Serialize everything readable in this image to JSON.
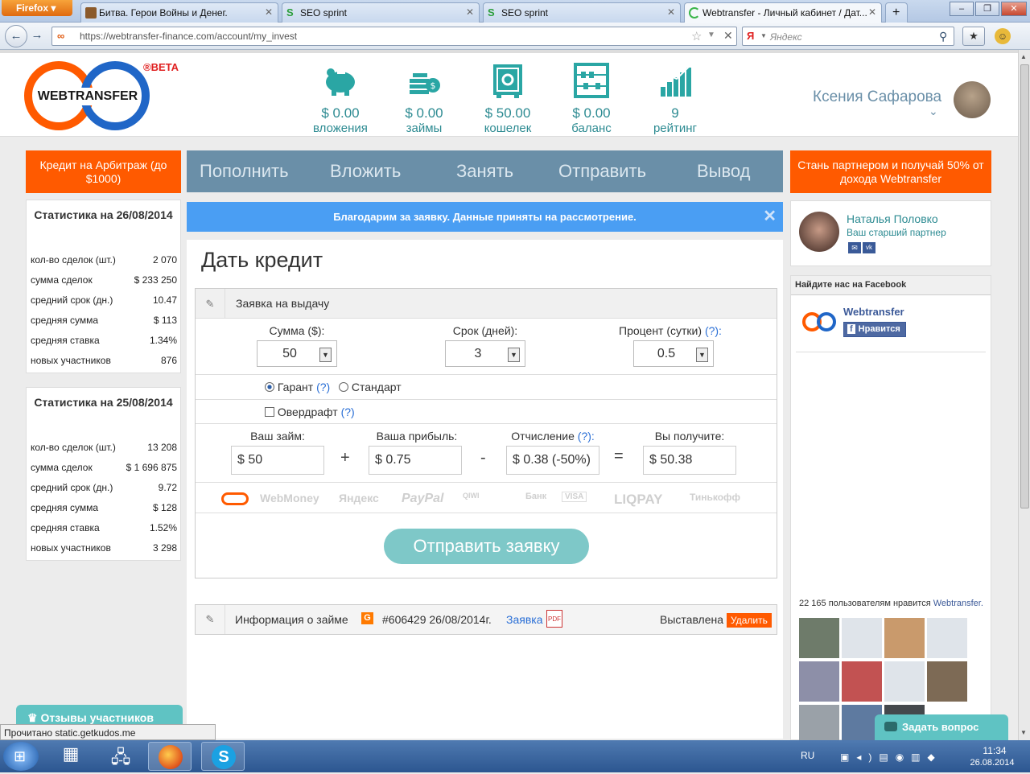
{
  "browser": {
    "firefox_button": "Firefox",
    "tabs": [
      {
        "title": "Битва. Герои Войны и Денег."
      },
      {
        "title": "SEO sprint"
      },
      {
        "title": "SEO sprint"
      },
      {
        "title": "Webtransfer - Личный кабинет / Дат..."
      }
    ],
    "new_tab": "+",
    "url": "https://webtransfer-finance.com/account/my_invest",
    "search_engine": "Яндекс"
  },
  "header": {
    "logo_text": "WEBTRANSFER",
    "beta": "®BETA",
    "stats": [
      {
        "value": "$ 0.00",
        "label": "вложения",
        "icon": "piggy-bank-icon"
      },
      {
        "value": "$ 0.00",
        "label": "займы",
        "icon": "coins-icon"
      },
      {
        "value": "$ 50.00",
        "label": "кошелек",
        "icon": "safe-icon"
      },
      {
        "value": "$ 0.00",
        "label": "баланс",
        "icon": "abacus-icon"
      },
      {
        "value": "9",
        "label": "рейтинг",
        "icon": "rating-chart-icon"
      }
    ],
    "user_name": "Ксения Сафарова"
  },
  "left_promo": "Кредит на Арбитраж (до $1000)",
  "right_promo": "Стань партнером и получай 50% от дохода Webtransfer",
  "menu": [
    "Пополнить",
    "Вложить",
    "Занять",
    "Отправить",
    "Вывод"
  ],
  "stats_blocks": [
    {
      "title": "Статистика на 26/08/2014",
      "rows": [
        {
          "label": "кол-во сделок (шт.)",
          "value": "2 070"
        },
        {
          "label": "сумма сделок",
          "value": "$ 233 250"
        },
        {
          "label": "средний срок (дн.)",
          "value": "10.47"
        },
        {
          "label": "средняя сумма",
          "value": "$ 113"
        },
        {
          "label": "средняя ставка",
          "value": "1.34%"
        },
        {
          "label": "новых участников",
          "value": "876"
        }
      ]
    },
    {
      "title": "Статистика на 25/08/2014",
      "rows": [
        {
          "label": "кол-во сделок (шт.)",
          "value": "13 208"
        },
        {
          "label": "сумма сделок",
          "value": "$ 1 696 875"
        },
        {
          "label": "средний срок (дн.)",
          "value": "9.72"
        },
        {
          "label": "средняя сумма",
          "value": "$ 128"
        },
        {
          "label": "средняя ставка",
          "value": "1.52%"
        },
        {
          "label": "новых участников",
          "value": "3 298"
        }
      ]
    }
  ],
  "reviews_tab": "Отзывы участников",
  "notice": "Благодарим за заявку. Данные приняты на рассмотрение.",
  "form": {
    "title": "Дать кредит",
    "section_title": "Заявка на выдачу",
    "amount_label": "Сумма ($):",
    "amount_value": "50",
    "term_label": "Срок (дней):",
    "term_value": "3",
    "rate_label": "Процент (сутки)",
    "rate_help": "(?):",
    "rate_value": "0.5",
    "garant_label": "Гарант",
    "garant_help": "(?)",
    "standard_label": "Стандарт",
    "overdraft_label": "Овердрафт",
    "overdraft_help": "(?)",
    "loan_label": "Ваш займ:",
    "loan_value": "$ 50",
    "profit_label": "Ваша прибыль:",
    "profit_value": "$ 0.75",
    "fee_label": "Отчисление",
    "fee_help": "(?):",
    "fee_value": "$ 0.38 (-50%)",
    "receive_label": "Вы получите:",
    "receive_value": "$ 50.38",
    "payment_methods": [
      "WebMoney",
      "Яндекс",
      "PayPal",
      "QIWI",
      "Банк",
      "VISA",
      "LIQPAY",
      "Тинькофф"
    ],
    "submit": "Отправить заявку"
  },
  "loan_info": {
    "title": "Информация о займе",
    "badge": "G",
    "number": "#606429 26/08/2014г.",
    "link": "Заявка",
    "status": "Выставлена",
    "delete": "Удалить"
  },
  "partner": {
    "name": "Наталья Половко",
    "role": "Ваш старший партнер"
  },
  "facebook": {
    "title": "Найдите нас на Facebook",
    "page_name": "Webtransfer",
    "like_button": "Нравится",
    "likes_text": "22 165 пользователям нравится",
    "likes_link": "Webtransfer."
  },
  "ask_button": "Задать вопрос",
  "statusbar": "Прочитано static.getkudos.me",
  "taskbar": {
    "lang": "RU",
    "time": "11:34",
    "date": "26.08.2014"
  },
  "colors": {
    "accent": "#ff5a00",
    "teal": "#2d8b92",
    "menu": "#6a8fa8",
    "notice": "#4a9ef3"
  }
}
